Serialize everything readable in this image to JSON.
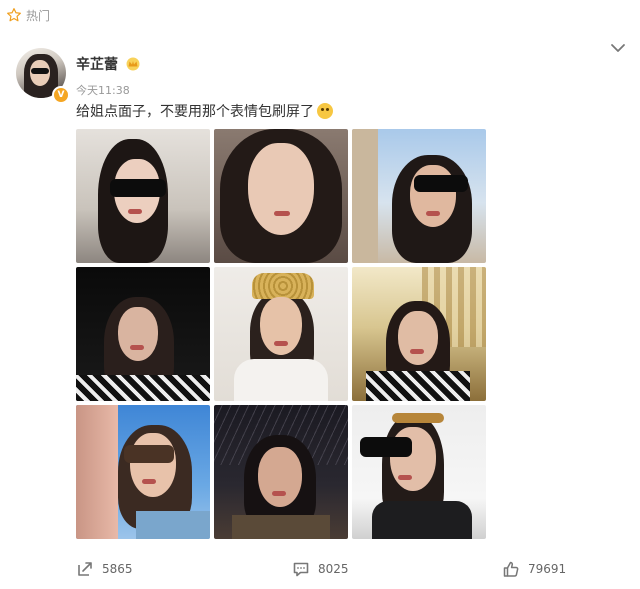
{
  "header": {
    "hot_label": "热门",
    "hot_icon": "star-outline-icon"
  },
  "post": {
    "author": "辛芷蕾",
    "verified_badge": "V",
    "time": "今天11:38",
    "text": "给姐点面子，不要用那个表情包刷屏了",
    "images": [
      {
        "name": "selfie-car-sunglasses"
      },
      {
        "name": "selfie-closeup"
      },
      {
        "name": "selfie-sky-sunglasses"
      },
      {
        "name": "selfie-dark-striped"
      },
      {
        "name": "selfie-headpiece"
      },
      {
        "name": "selfie-building-striped"
      },
      {
        "name": "selfie-blue-sky-sunglasses"
      },
      {
        "name": "selfie-night-trees"
      },
      {
        "name": "selfie-headband-sunglasses"
      }
    ]
  },
  "actions": {
    "repost_count": "5865",
    "comment_count": "8025",
    "like_count": "79691"
  },
  "colors": {
    "accent": "#f5a623",
    "muted": "#999999",
    "text": "#333333"
  }
}
